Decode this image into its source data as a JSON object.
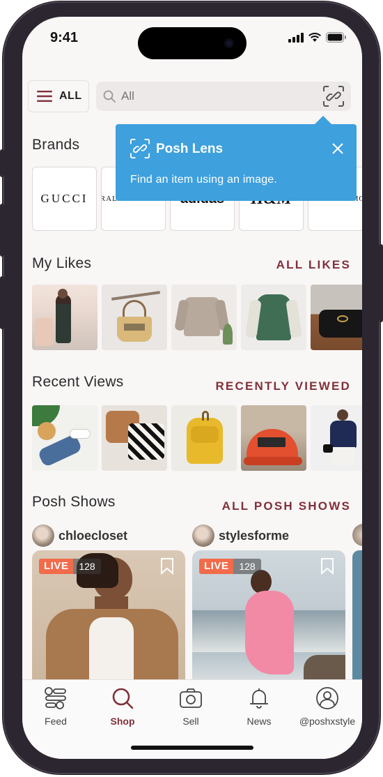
{
  "status": {
    "time": "9:41"
  },
  "topbar": {
    "menu_label": "ALL",
    "search_placeholder": "All"
  },
  "tooltip": {
    "title": "Posh Lens",
    "body": "Find an item using an image."
  },
  "brands": {
    "title": "Brands",
    "items": [
      "GUCCI",
      "RALPH LAUREN",
      "adidas",
      "H&M",
      "TOMMY HILFIGER"
    ]
  },
  "likes": {
    "title": "My Likes",
    "link": "ALL LIKES",
    "items": [
      "floral dress",
      "woven straw bag",
      "beige sweater",
      "green hoodie",
      "black quilted bag"
    ]
  },
  "recent": {
    "title": "Recent Views",
    "link": "RECENTLY VIEWED",
    "items": [
      "white mules",
      "throw pillows",
      "yellow backpack",
      "red cap",
      "navy sweater outfit"
    ]
  },
  "shows": {
    "title": "Posh Shows",
    "link": "ALL POSH SHOWS",
    "items": [
      {
        "seller": "chloecloset",
        "live": "LIVE",
        "viewers": "128"
      },
      {
        "seller": "stylesforme",
        "live": "LIVE",
        "viewers": "128"
      }
    ]
  },
  "tabs": [
    {
      "label": "Feed",
      "icon": "feed-icon"
    },
    {
      "label": "Shop",
      "icon": "search-icon",
      "active": true
    },
    {
      "label": "Sell",
      "icon": "camera-icon"
    },
    {
      "label": "News",
      "icon": "bell-icon"
    },
    {
      "label": "@poshxstyle",
      "icon": "profile-icon"
    }
  ],
  "colors": {
    "accent": "#80303a",
    "tooltip": "#3ea0dd",
    "live": "#f26b4b"
  }
}
